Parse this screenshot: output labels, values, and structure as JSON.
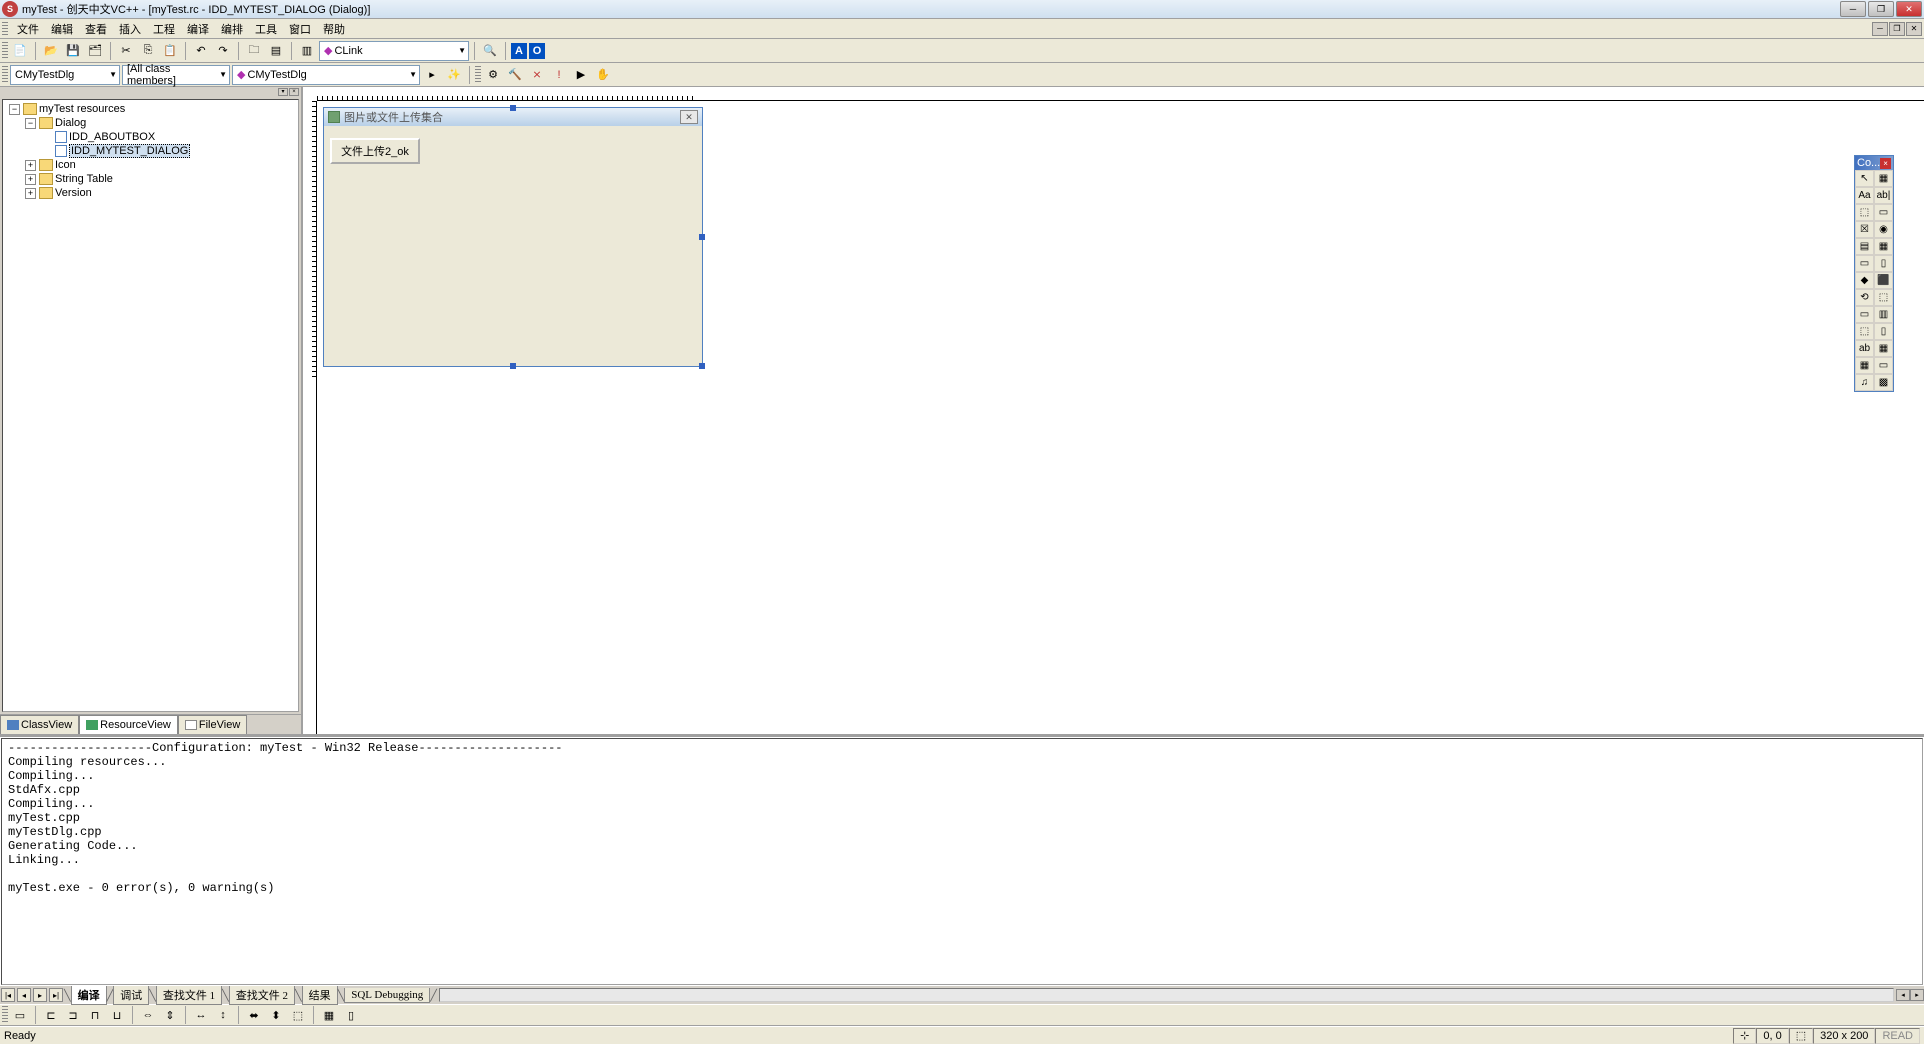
{
  "window": {
    "title": "myTest - 创天中文VC++ - [myTest.rc - IDD_MYTEST_DIALOG (Dialog)]"
  },
  "menu": {
    "items": [
      "文件",
      "编辑",
      "查看",
      "插入",
      "工程",
      "编译",
      "编排",
      "工具",
      "窗口",
      "帮助"
    ]
  },
  "toolbar1": {
    "combo": "CLink"
  },
  "toolbar2": {
    "class_combo": "CMyTestDlg",
    "filter_combo": "[All class members]",
    "member_combo": "CMyTestDlg"
  },
  "tree": {
    "root": "myTest resources",
    "dialog_folder": "Dialog",
    "dialog_items": [
      "IDD_ABOUTBOX",
      "IDD_MYTEST_DIALOG"
    ],
    "icon_folder": "Icon",
    "string_folder": "String Table",
    "version_folder": "Version"
  },
  "left_tabs": [
    "ClassView",
    "ResourceView",
    "FileView"
  ],
  "dialog_editor": {
    "title": "图片或文件上传集合",
    "button_label": "文件上传2_ok"
  },
  "controls_palette": {
    "title": "Co...",
    "tools": [
      "↖",
      "▦",
      "Aa",
      "ab|",
      "⬚",
      "▭",
      "☒",
      "◉",
      "▤",
      "▦",
      "▭",
      "▯",
      "◆",
      "⬛",
      "⟲",
      "⬚",
      "▭",
      "▥",
      "⬚",
      "▯",
      "ab",
      "▦",
      "▦",
      "▭",
      "♫",
      "▩"
    ]
  },
  "output": {
    "text": "--------------------Configuration: myTest - Win32 Release--------------------\nCompiling resources...\nCompiling...\nStdAfx.cpp\nCompiling...\nmyTest.cpp\nmyTestDlg.cpp\nGenerating Code...\nLinking...\n\nmyTest.exe - 0 error(s), 0 warning(s)",
    "tabs": [
      "编译",
      "调试",
      "查找文件 1",
      "查找文件 2",
      "结果",
      "SQL Debugging"
    ]
  },
  "statusbar": {
    "ready": "Ready",
    "pos": "0, 0",
    "size": "320 x 200",
    "read": "READ"
  }
}
